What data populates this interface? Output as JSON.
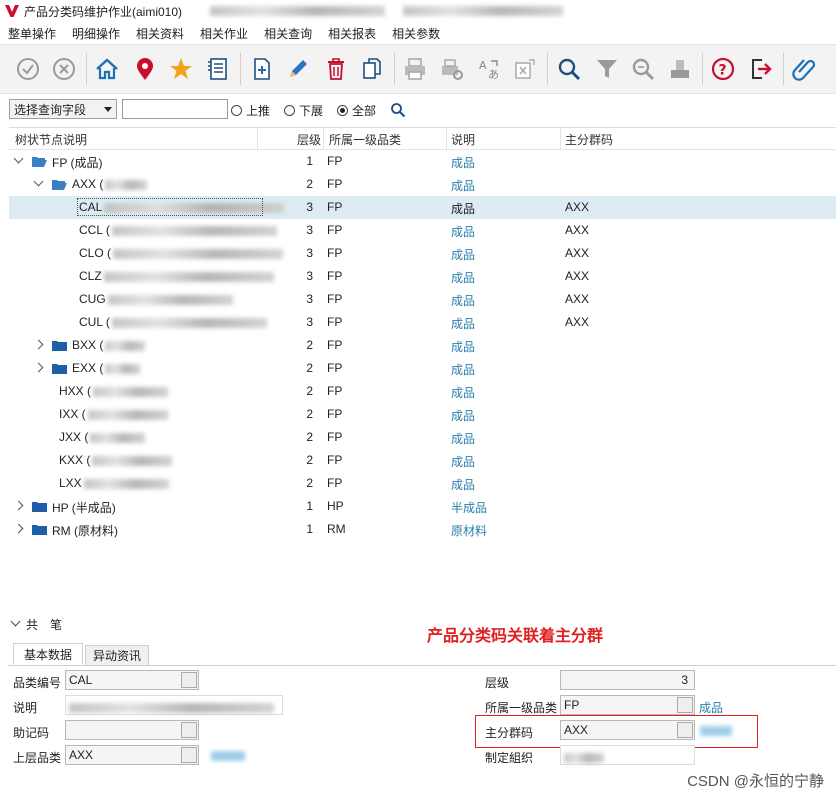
{
  "window": {
    "title": "产品分类码维护作业(aimi010)",
    "brand_color": "#c8102e"
  },
  "menu": [
    "整单操作",
    "明细操作",
    "相关资料",
    "相关作业",
    "相关查询",
    "相关报表",
    "相关参数"
  ],
  "toolbar": {
    "buttons": [
      {
        "icon": "check-circle-icon"
      },
      {
        "icon": "cancel-circle-icon"
      },
      {
        "icon": "home-icon"
      },
      {
        "icon": "location-pin-icon"
      },
      {
        "icon": "star-icon"
      },
      {
        "icon": "list-icon"
      },
      {
        "icon": "add-page-icon"
      },
      {
        "icon": "edit-pencil-icon"
      },
      {
        "icon": "trash-icon"
      },
      {
        "icon": "copy-icon"
      },
      {
        "icon": "print-icon"
      },
      {
        "icon": "print-setup-icon"
      },
      {
        "icon": "translate-icon"
      },
      {
        "icon": "export-icon"
      },
      {
        "icon": "search-icon"
      },
      {
        "icon": "filter-icon"
      },
      {
        "icon": "query-icon"
      },
      {
        "icon": "stamp-icon"
      },
      {
        "icon": "help-icon"
      },
      {
        "icon": "exit-icon"
      },
      {
        "icon": "attachment-icon"
      }
    ]
  },
  "search": {
    "field_select": "选择查询字段",
    "query_value": "",
    "radio_up": "上推",
    "radio_down": "下展",
    "radio_all": "全部",
    "selected": "全部"
  },
  "tree": {
    "columns": {
      "name": "树状节点说明",
      "level": "层级",
      "category": "所属一级品类",
      "desc": "说明",
      "group": "主分群码"
    },
    "rows": [
      {
        "depth": 0,
        "expand": "down",
        "folder": "open",
        "code": "FP (成品)",
        "level": "1",
        "category": "FP",
        "desc": "成品",
        "group": ""
      },
      {
        "depth": 1,
        "expand": "down",
        "folder": "open",
        "code": "AXX (",
        "level": "2",
        "category": "FP",
        "desc": "成品",
        "group": ""
      },
      {
        "depth": 2,
        "expand": "",
        "folder": "",
        "code": "CAL",
        "level": "3",
        "category": "FP",
        "desc": "成品",
        "group": "AXX",
        "selected": true
      },
      {
        "depth": 2,
        "expand": "",
        "folder": "",
        "code": "CCL (",
        "level": "3",
        "category": "FP",
        "desc": "成品",
        "group": "AXX"
      },
      {
        "depth": 2,
        "expand": "",
        "folder": "",
        "code": "CLO (",
        "level": "3",
        "category": "FP",
        "desc": "成品",
        "group": "AXX"
      },
      {
        "depth": 2,
        "expand": "",
        "folder": "",
        "code": "CLZ",
        "level": "3",
        "category": "FP",
        "desc": "成品",
        "group": "AXX"
      },
      {
        "depth": 2,
        "expand": "",
        "folder": "",
        "code": "CUG",
        "level": "3",
        "category": "FP",
        "desc": "成品",
        "group": "AXX"
      },
      {
        "depth": 2,
        "expand": "",
        "folder": "",
        "code": "CUL (",
        "level": "3",
        "category": "FP",
        "desc": "成品",
        "group": "AXX"
      },
      {
        "depth": 1,
        "expand": "right",
        "folder": "closed",
        "code": "BXX (",
        "level": "2",
        "category": "FP",
        "desc": "成品",
        "group": ""
      },
      {
        "depth": 1,
        "expand": "right",
        "folder": "closed",
        "code": "EXX (",
        "level": "2",
        "category": "FP",
        "desc": "成品",
        "group": ""
      },
      {
        "depth": 1,
        "expand": "",
        "folder": "",
        "code": "HXX (",
        "level": "2",
        "category": "FP",
        "desc": "成品",
        "group": ""
      },
      {
        "depth": 1,
        "expand": "",
        "folder": "",
        "code": "IXX (",
        "level": "2",
        "category": "FP",
        "desc": "成品",
        "group": ""
      },
      {
        "depth": 1,
        "expand": "",
        "folder": "",
        "code": "JXX (",
        "level": "2",
        "category": "FP",
        "desc": "成品",
        "group": ""
      },
      {
        "depth": 1,
        "expand": "",
        "folder": "",
        "code": "KXX (",
        "level": "2",
        "category": "FP",
        "desc": "成品",
        "group": ""
      },
      {
        "depth": 1,
        "expand": "",
        "folder": "",
        "code": "LXX",
        "level": "2",
        "category": "FP",
        "desc": "成品",
        "group": ""
      },
      {
        "depth": 0,
        "expand": "right",
        "folder": "closed",
        "code": "HP (半成品)",
        "level": "1",
        "category": "HP",
        "desc": "半成品",
        "group": ""
      },
      {
        "depth": 0,
        "expand": "right",
        "folder": "closed",
        "code": "RM (原材料)",
        "level": "1",
        "category": "RM",
        "desc": "原材料",
        "group": ""
      }
    ]
  },
  "detail": {
    "section_label": "共　笔",
    "annotation": "产品分类码关联着主分群",
    "tabs": [
      "基本数据",
      "异动资讯"
    ],
    "fields": {
      "code_label": "品类编号",
      "code_value": "CAL",
      "desc_label": "说明",
      "memo_label": "助记码",
      "parent_label": "上层品类",
      "parent_value": "AXX",
      "level_label": "层级",
      "level_value": "3",
      "category_label": "所属一级品类",
      "category_value": "FP",
      "category_desc": "成品",
      "group_label": "主分群码",
      "group_value": "AXX",
      "org_label": "制定組织"
    },
    "highlight_color": "#e02020"
  },
  "watermark": "CSDN @永恒的宁静"
}
